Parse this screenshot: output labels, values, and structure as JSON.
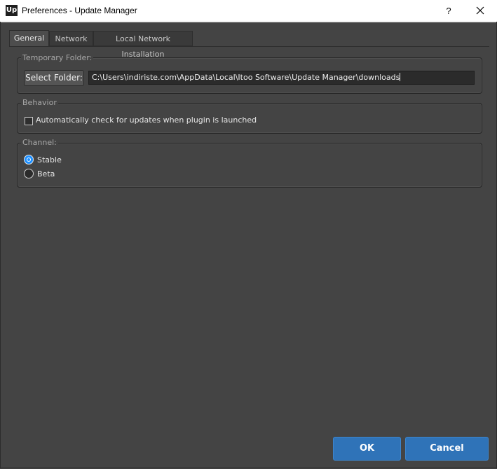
{
  "window": {
    "app_icon_text": "Up",
    "title": "Preferences - Update Manager",
    "help_label": "?",
    "close_icon": "close-icon"
  },
  "tabs": [
    {
      "label": "General",
      "active": true
    },
    {
      "label": "Network",
      "active": false
    },
    {
      "label": "Local Network Installation",
      "active": false
    }
  ],
  "temporary_folder": {
    "title": "Temporary Folder:",
    "button_label": "Select Folder:",
    "path": "C:\\Users\\indiriste.com\\AppData\\Local\\Itoo Software\\Update Manager\\downloads"
  },
  "behavior": {
    "title": "Behavior",
    "auto_check_label": "Automatically check for updates when plugin is launched",
    "auto_check_checked": false
  },
  "channel": {
    "title": "Channel:",
    "options": [
      {
        "label": "Stable",
        "selected": true
      },
      {
        "label": "Beta",
        "selected": false
      }
    ]
  },
  "footer": {
    "ok_label": "OK",
    "cancel_label": "Cancel"
  },
  "colors": {
    "background": "#444444",
    "accent": "#2f73b8",
    "radio_selected": "#1e90ff"
  }
}
